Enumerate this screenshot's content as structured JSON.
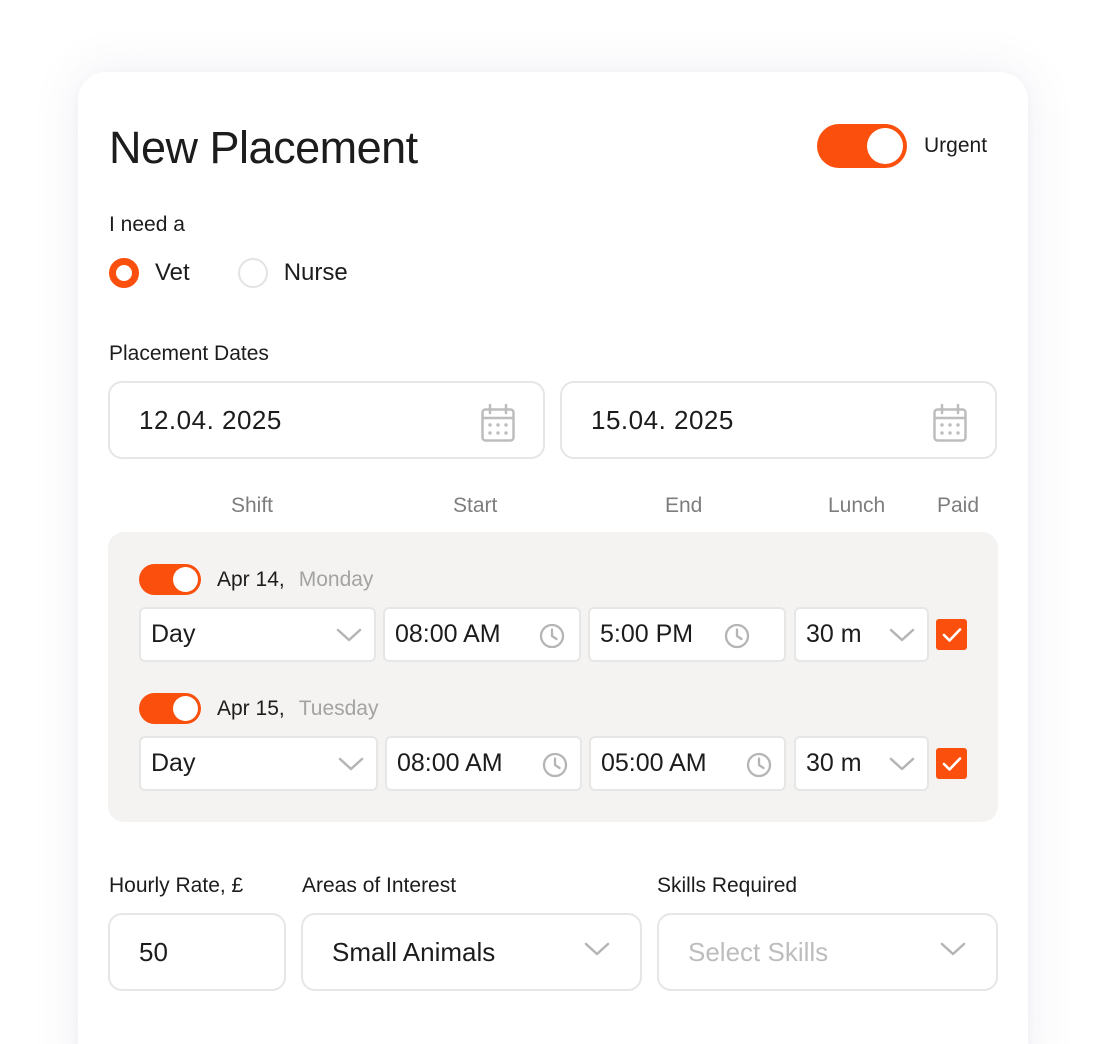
{
  "header": {
    "title": "New Placement",
    "urgent_label": "Urgent",
    "urgent_on": true
  },
  "role": {
    "label": "I need a",
    "options": [
      {
        "label": "Vet",
        "checked": true
      },
      {
        "label": "Nurse",
        "checked": false
      }
    ]
  },
  "dates": {
    "label": "Placement Dates",
    "start": "12.04. 2025",
    "end": "15.04. 2025"
  },
  "columns": {
    "shift": "Shift",
    "start": "Start",
    "end": "End",
    "lunch": "Lunch",
    "paid": "Paid"
  },
  "days": [
    {
      "enabled": true,
      "date": "Apr 14,",
      "weekday": "Monday",
      "shift": "Day",
      "start": "08:00 AM",
      "end": "5:00 PM",
      "lunch": "30 m",
      "paid": true
    },
    {
      "enabled": true,
      "date": "Apr 15,",
      "weekday": "Tuesday",
      "shift": "Day",
      "start": "08:00 AM",
      "end": "05:00 AM",
      "lunch": "30 m",
      "paid": true
    }
  ],
  "rate": {
    "label": "Hourly Rate, £",
    "value": "50"
  },
  "interest": {
    "label": "Areas of Interest",
    "value": "Small Animals"
  },
  "skills": {
    "label": "Skills Required",
    "placeholder": "Select Skills"
  },
  "colors": {
    "accent": "#fb4f0d",
    "panel": "#f4f3f1",
    "border": "#e6e6e6",
    "muted": "#7d7d7d"
  }
}
